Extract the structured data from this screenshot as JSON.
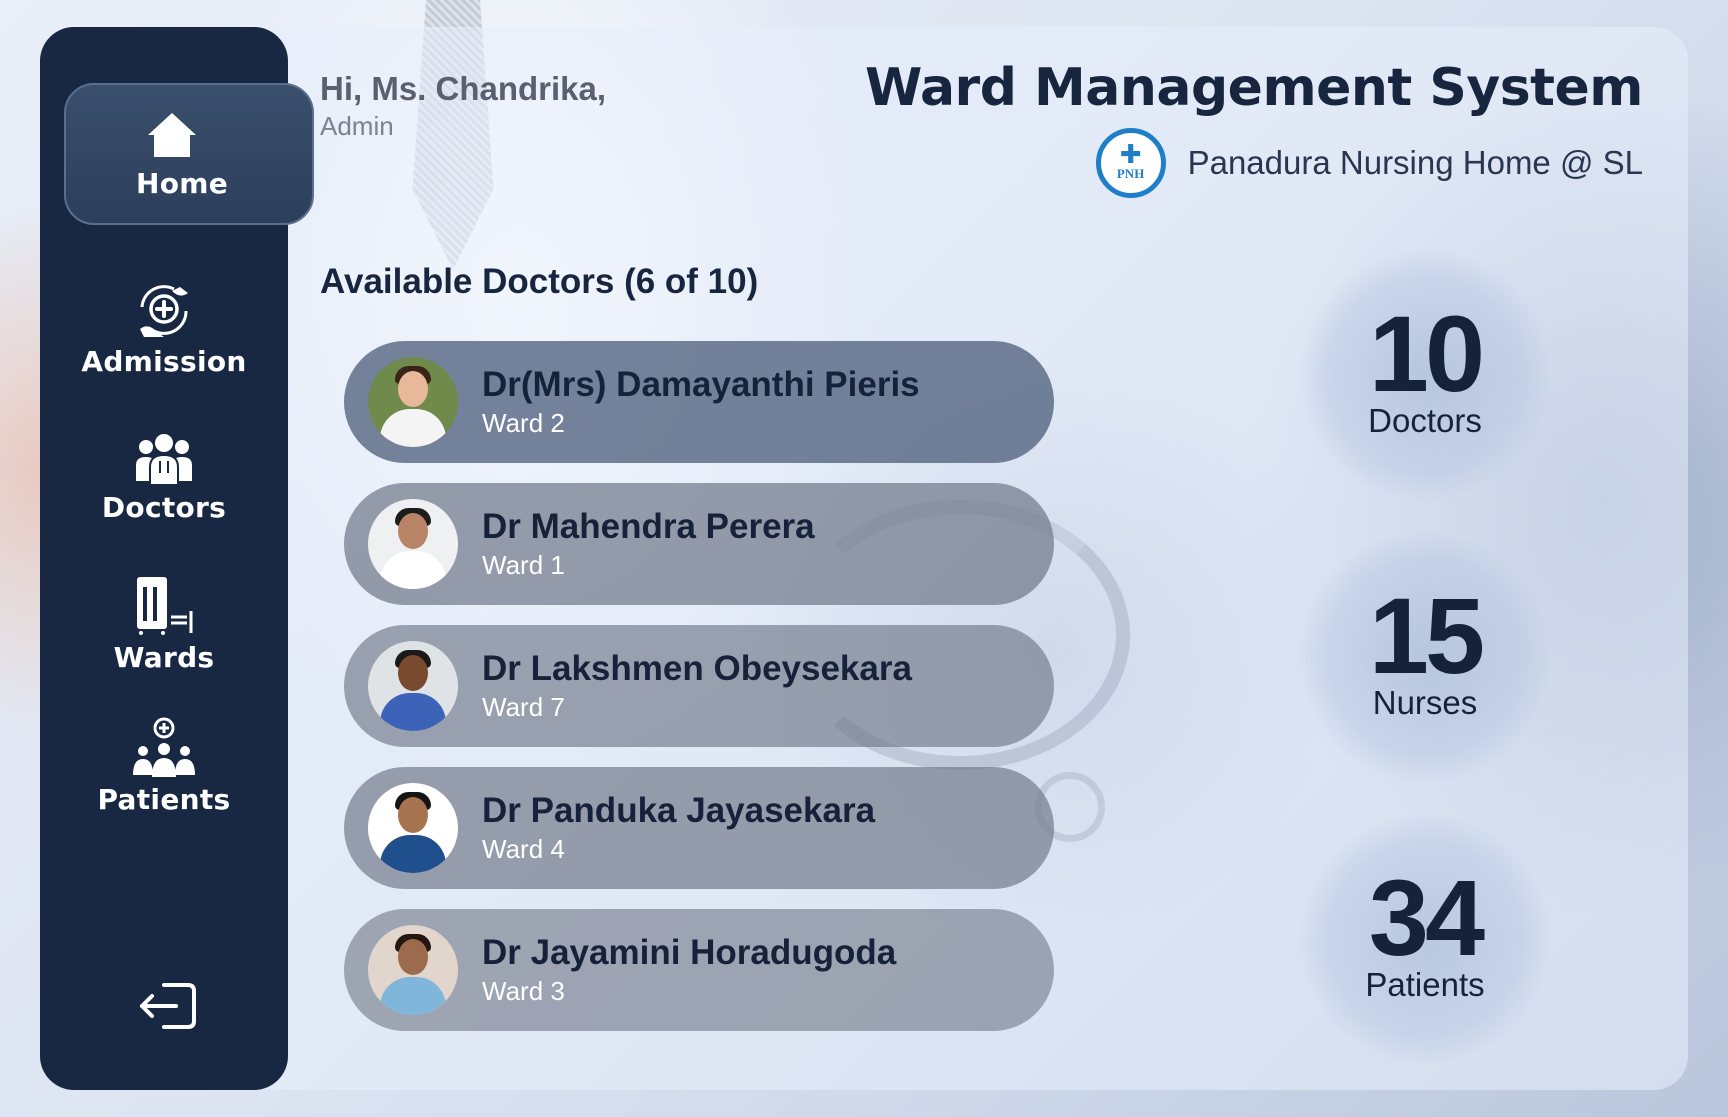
{
  "header": {
    "greeting": "Hi, Ms. Chandrika,",
    "role": "Admin",
    "app_title": "Ward Management System",
    "org_name": "Panadura Nursing Home @ SL",
    "org_logo_text": "PNH"
  },
  "sidebar": {
    "items": [
      {
        "label": "Home",
        "icon": "home-icon",
        "active": true
      },
      {
        "label": "Admission",
        "icon": "admission-icon"
      },
      {
        "label": "Doctors",
        "icon": "doctors-icon"
      },
      {
        "label": "Wards",
        "icon": "wards-icon"
      },
      {
        "label": "Patients",
        "icon": "patients-icon"
      }
    ],
    "logout_icon": "logout-icon"
  },
  "doctors": {
    "title": "Available Doctors (6 of 10)",
    "list": [
      {
        "name": "Dr(Mrs) Damayanthi Pieris",
        "ward": "Ward 2"
      },
      {
        "name": "Dr Mahendra Perera",
        "ward": "Ward 1"
      },
      {
        "name": "Dr Lakshmen Obeysekara",
        "ward": "Ward 7"
      },
      {
        "name": "Dr Panduka Jayasekara",
        "ward": "Ward 4"
      },
      {
        "name": "Dr Jayamini Horadugoda",
        "ward": "Ward 3"
      }
    ]
  },
  "stats": [
    {
      "value": "10",
      "label": "Doctors"
    },
    {
      "value": "15",
      "label": "Nurses"
    },
    {
      "value": "34",
      "label": "Patients"
    }
  ],
  "colors": {
    "sidebar_bg": "#182842",
    "title_text": "#18253f",
    "logo_blue": "#1e7fc8"
  }
}
